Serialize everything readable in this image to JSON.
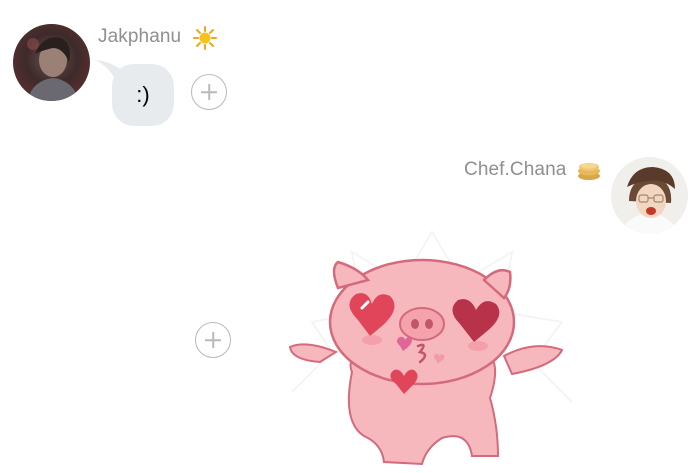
{
  "messages": [
    {
      "sender": "Jakphanu",
      "sender_badge_icon": "sun-icon",
      "text": ":)",
      "side": "left"
    },
    {
      "sender": "Chef.Chana",
      "sender_badge_icon": "pancake-icon",
      "sticker": "pig-in-love-sticker",
      "side": "right"
    }
  ],
  "colors": {
    "bubble_bg": "#e8ebee",
    "name_text": "#8f8f8f",
    "react_border": "#b9b9b9",
    "pig_pink": "#f7b8bd",
    "heart_red": "#e0455a"
  }
}
